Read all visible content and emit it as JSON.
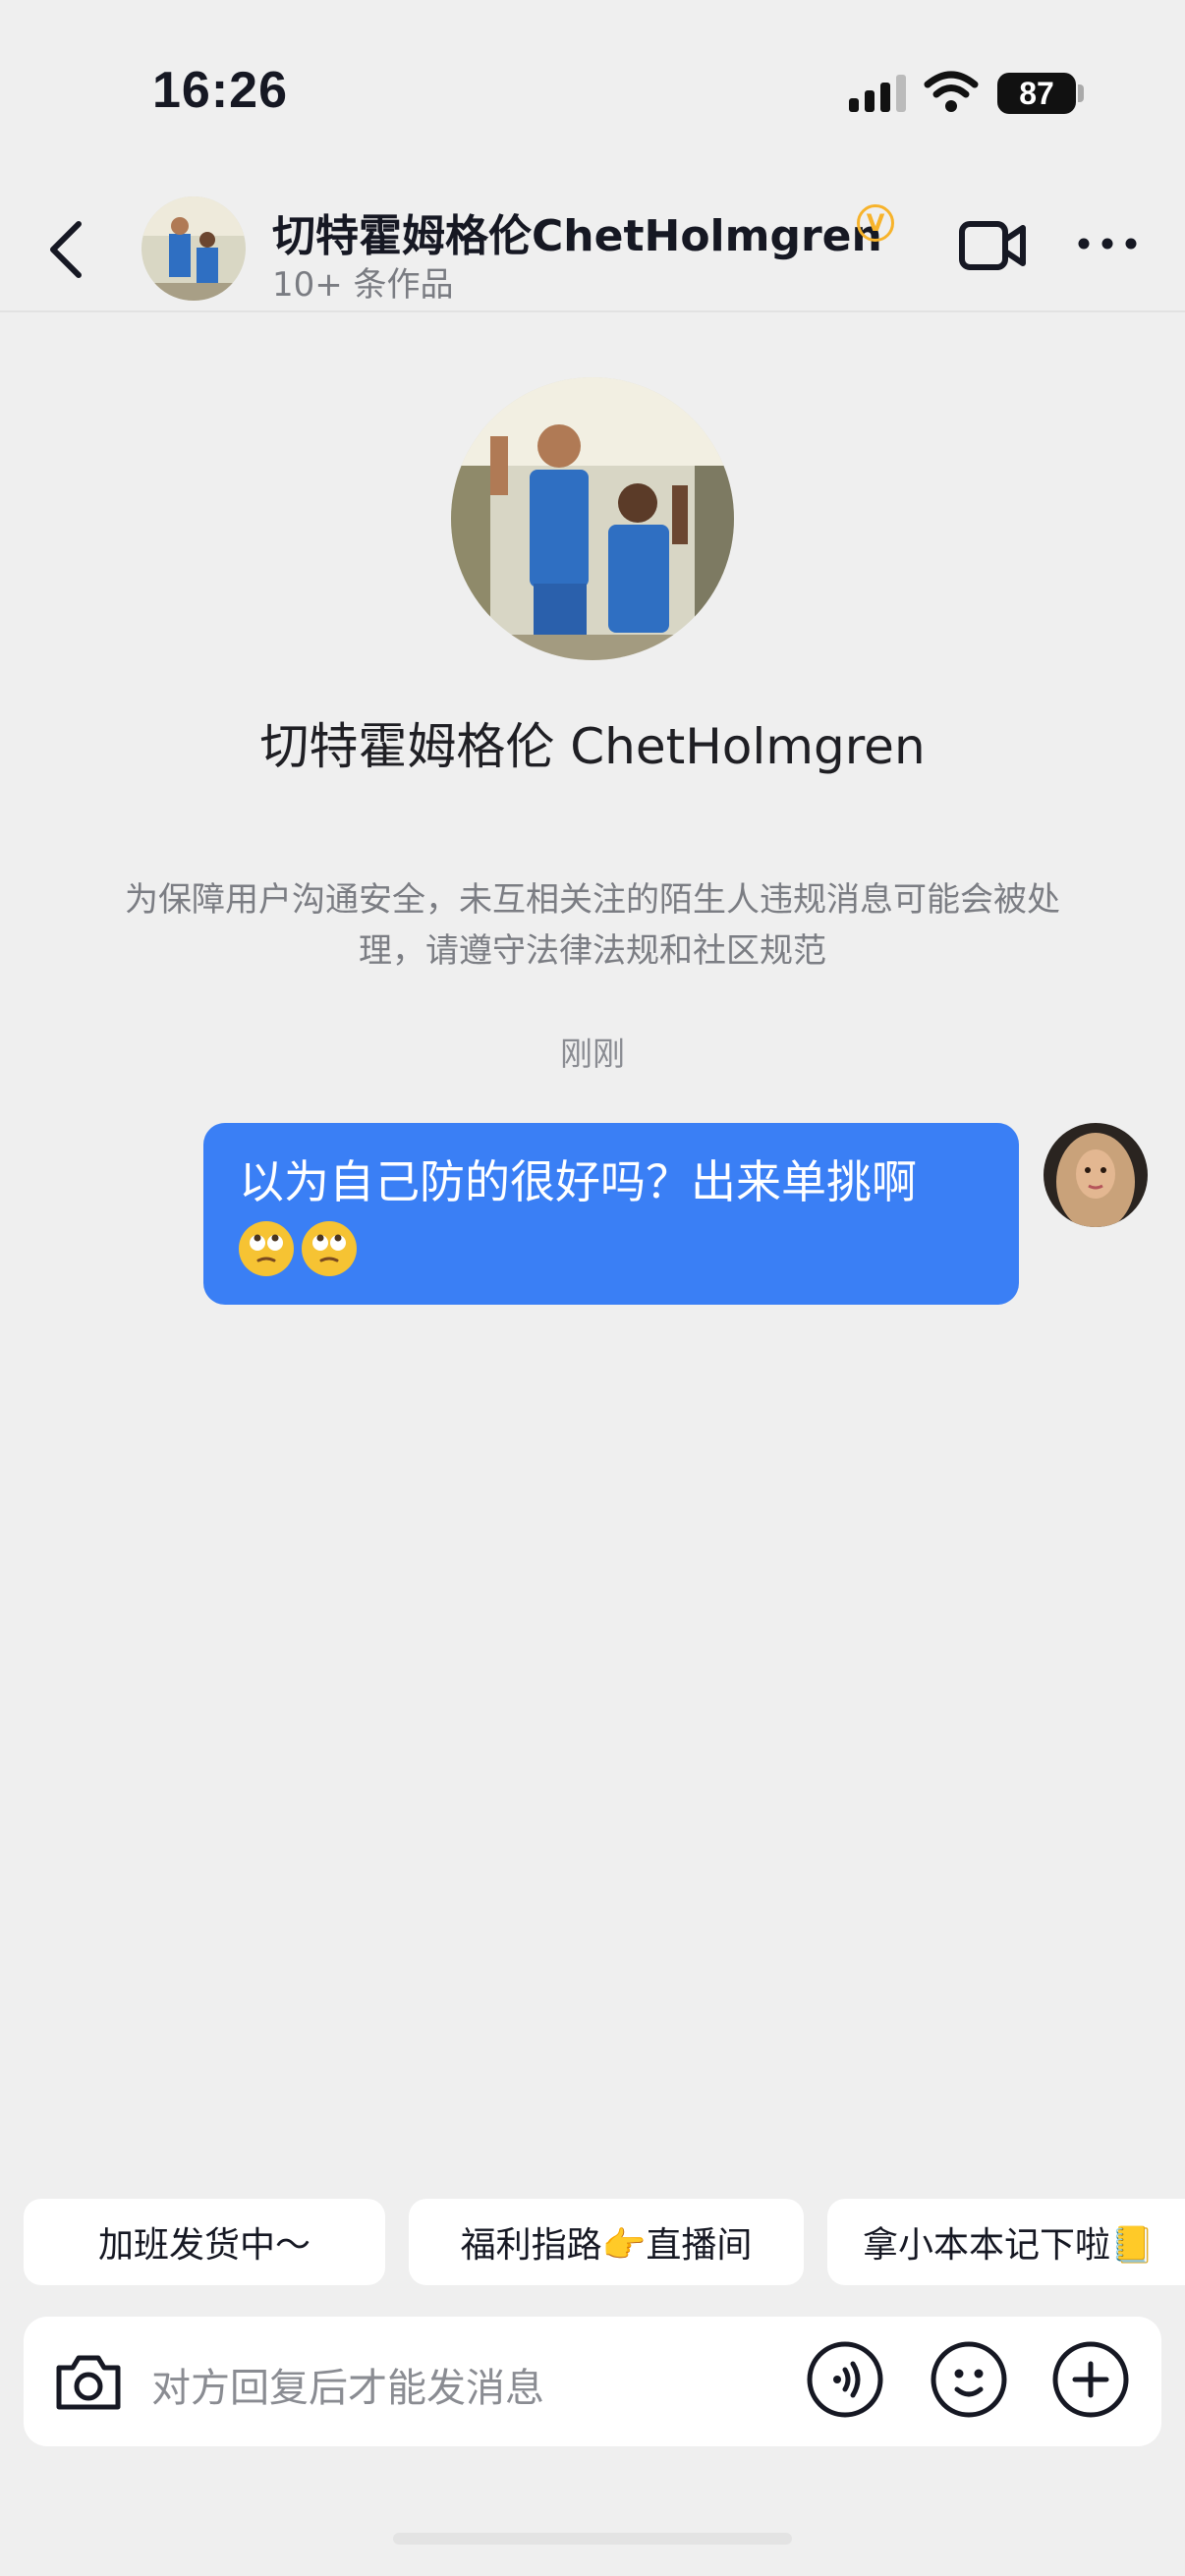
{
  "status_bar": {
    "time": "16:26",
    "battery": "87"
  },
  "header": {
    "name": "切特霍姆格伦ChetHolmgren",
    "verified_mark": "V",
    "subtitle": "10+ 条作品",
    "icons": [
      "back-icon",
      "video-call-icon",
      "more-icon"
    ]
  },
  "profile": {
    "name": "切特霍姆格伦 ChetHolmgren"
  },
  "notice": "为保障用户沟通安全，未互相关注的陌生人违规消息可能会被处理，请遵守法律法规和社区规范",
  "timestamp": "刚刚",
  "message": {
    "text": "以为自己防的很好吗？出来单挑啊",
    "emojis": [
      "eye-roll-emoji",
      "eye-roll-emoji"
    ]
  },
  "quick_replies": [
    "加班发货中～",
    "福利指路👉直播间",
    "拿小本本记下啦📒"
  ],
  "input": {
    "placeholder": "对方回复后才能发消息"
  },
  "colors": {
    "bubble": "#3a7ff5",
    "background": "#efefef",
    "verified": "#f7b32b"
  }
}
